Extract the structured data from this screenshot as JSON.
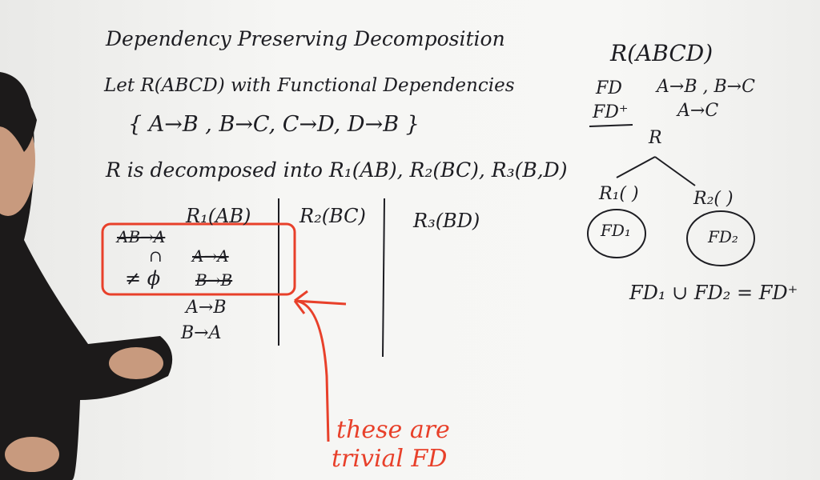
{
  "board": {
    "title": "Dependency Preserving Decomposition",
    "line1": "Let R(ABCD) with Functional Dependencies",
    "fd_set": "{ A→B , B→C, C→D, D→B }",
    "decomposed": "R is decomposed into R₁(AB), R₂(BC), R₃(B,D)",
    "table": {
      "col1_header": "R₁(AB)",
      "col2_header": "R₂(BC)",
      "col3_header": "R₃(BD)",
      "struck_fd_1": "AB→A",
      "struck_fd_2": "A→A",
      "struck_fd_3": "B→B",
      "cap_symbol": "∩",
      "not_empty": "≠ ϕ",
      "fd_a_b": "A→B",
      "fd_b_a": "B→A"
    },
    "red_note_1": "these are",
    "red_note_2": "trivial FD",
    "right": {
      "relation": "R(ABCD)",
      "fd_label": "FD",
      "fd_values": "A→B , B→C",
      "fdplus_label": "FD⁺",
      "fdplus_value": "A→C",
      "root": "R",
      "child1": "R₁( )",
      "child2": "R₂(  )",
      "fd1": "FD₁",
      "fd2": "FD₂",
      "equation": "FD₁ ∪ FD₂ = FD⁺"
    }
  },
  "colors": {
    "ink": "#1d1d22",
    "marker_red": "#e8402a",
    "board": "#f4f4f2"
  }
}
